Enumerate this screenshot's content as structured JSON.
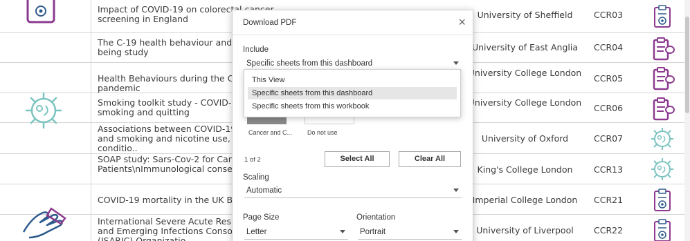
{
  "rows": [
    {
      "title": "Impact of COVID-19 on colorectal cancer screening in England",
      "institution": "University of Sheffield",
      "code": "CCR03",
      "icon": "clipboard-pin-icon"
    },
    {
      "title": "The C-19 health behaviour and well-being study",
      "institution": "University of East Anglia",
      "code": "CCR04",
      "icon": "clipboard-speech-icon"
    },
    {
      "title": "Health Behaviours during the COVID-19 pandemic",
      "institution": "University College London",
      "code": "CCR05",
      "icon": "clipboard-speech-icon"
    },
    {
      "title": "Smoking toolkit study - COVID-19 and smoking and quitting",
      "institution": "University College London",
      "code": "CCR06",
      "icon": "clipboard-speech-icon"
    },
    {
      "title": "Associations between COVID-19 infection and smoking and nicotine use, comorbid conditio..",
      "institution": "University of Oxford",
      "code": "CCR07",
      "icon": "virus-icon"
    },
    {
      "title": "SOAP study: Sars-Cov-2 for Cancer Patients\\nImmunological consequences ..",
      "institution": "King's College London",
      "code": "CCR13",
      "icon": "virus-icon"
    },
    {
      "title": "COVID-19 mortality in the UK Biobank",
      "institution": "Imperial College London",
      "code": "CCR21",
      "icon": "clipboard-pin-icon"
    },
    {
      "title": "International Severe Acute Respiratory and Emerging Infections Consortium (ISARIC) Organizatio",
      "institution": "University of Liverpool",
      "code": "CCR22",
      "icon": "clipboard-pin-icon"
    }
  ],
  "dialog": {
    "title": "Download PDF",
    "close": "×",
    "include_label": "Include",
    "include_value": "Specific sheets from this dashboard",
    "include_options": [
      "This View",
      "Specific sheets from this dashboard",
      "Specific sheets from this workbook"
    ],
    "selected_option": "Specific sheets from this dashboard",
    "sheets": [
      {
        "caption": "Cancer and C...",
        "selected": true
      },
      {
        "caption": "Do not use",
        "selected": false
      }
    ],
    "sheet_count": "1 of 2",
    "select_all": "Select All",
    "clear_all": "Clear All",
    "scaling_label": "Scaling",
    "scaling_value": "Automatic",
    "page_size_label": "Page Size",
    "page_size_value": "Letter",
    "orientation_label": "Orientation",
    "orientation_value": "Portrait"
  },
  "colors": {
    "accent_purple": "#8b3a8f",
    "accent_teal": "#7cc4c0",
    "icon_blue": "#2d5a8c"
  }
}
